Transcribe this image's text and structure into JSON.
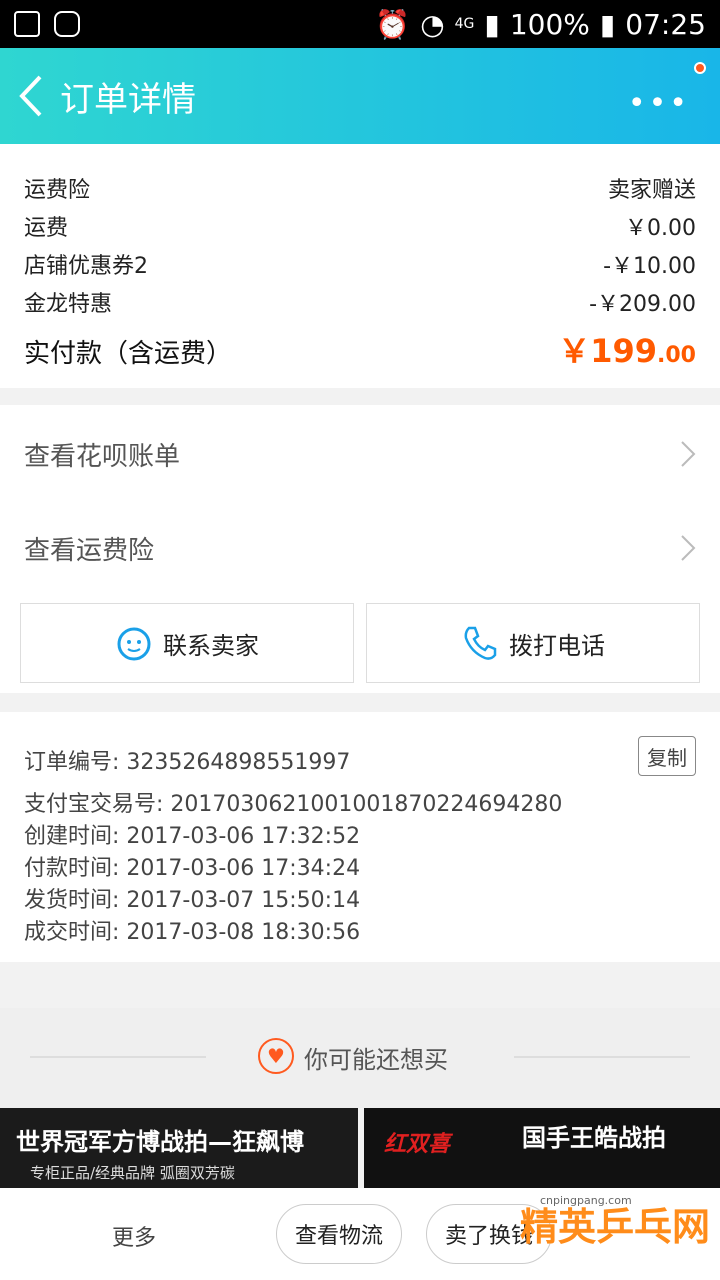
{
  "status_bar": {
    "network": "4G",
    "battery": "100%",
    "time": "07:25"
  },
  "nav": {
    "title": "订单详情",
    "more_label": "•••"
  },
  "cost_summary": {
    "rows": [
      {
        "label": "运费险",
        "value": "卖家赠送"
      },
      {
        "label": "运费",
        "value": "￥0.00"
      },
      {
        "label": "店铺优惠券2",
        "value": "-￥10.00"
      },
      {
        "label": "金龙特惠",
        "value": "-￥209.00"
      }
    ],
    "total_label": "实付款（含运费）",
    "total_currency": "￥",
    "total_int": "199",
    "total_dec": ".00"
  },
  "links": {
    "huabei": "查看花呗账单",
    "freight_insurance": "查看运费险"
  },
  "actions": {
    "contact_seller": "联系卖家",
    "call": "拨打电话"
  },
  "order_info": {
    "order_no_label": "订单编号:",
    "order_no": "3235264898551997",
    "copy_label": "复制",
    "alipay_label": "支付宝交易号:",
    "alipay_no": "2017030621001001870224694280",
    "created_label": "创建时间:",
    "created": "2017-03-06 17:32:52",
    "paid_label": "付款时间:",
    "paid": "2017-03-06 17:34:24",
    "shipped_label": "发货时间:",
    "shipped": "2017-03-07 15:50:14",
    "done_label": "成交时间:",
    "done": "2017-03-08 18:30:56"
  },
  "recommend": {
    "title": "你可能还想买"
  },
  "ads": {
    "ad1_title": "世界冠军方博战拍—狂飙博",
    "ad1_sub": "专柜正品/经典品牌  弧圈双芳碳",
    "ad2_logo": "红双喜",
    "ad2_title": "国手王皓战拍"
  },
  "bottom": {
    "more": "更多",
    "logistics": "查看物流",
    "resell": "卖了换钱"
  },
  "watermark": {
    "text": "精英乒乓网",
    "url": "cnpingpang.com"
  },
  "colors": {
    "accent": "#ff5a00",
    "nav_start": "#2fd6d1",
    "nav_end": "#19b6e8",
    "icon_blue": "#1aa0e8"
  }
}
